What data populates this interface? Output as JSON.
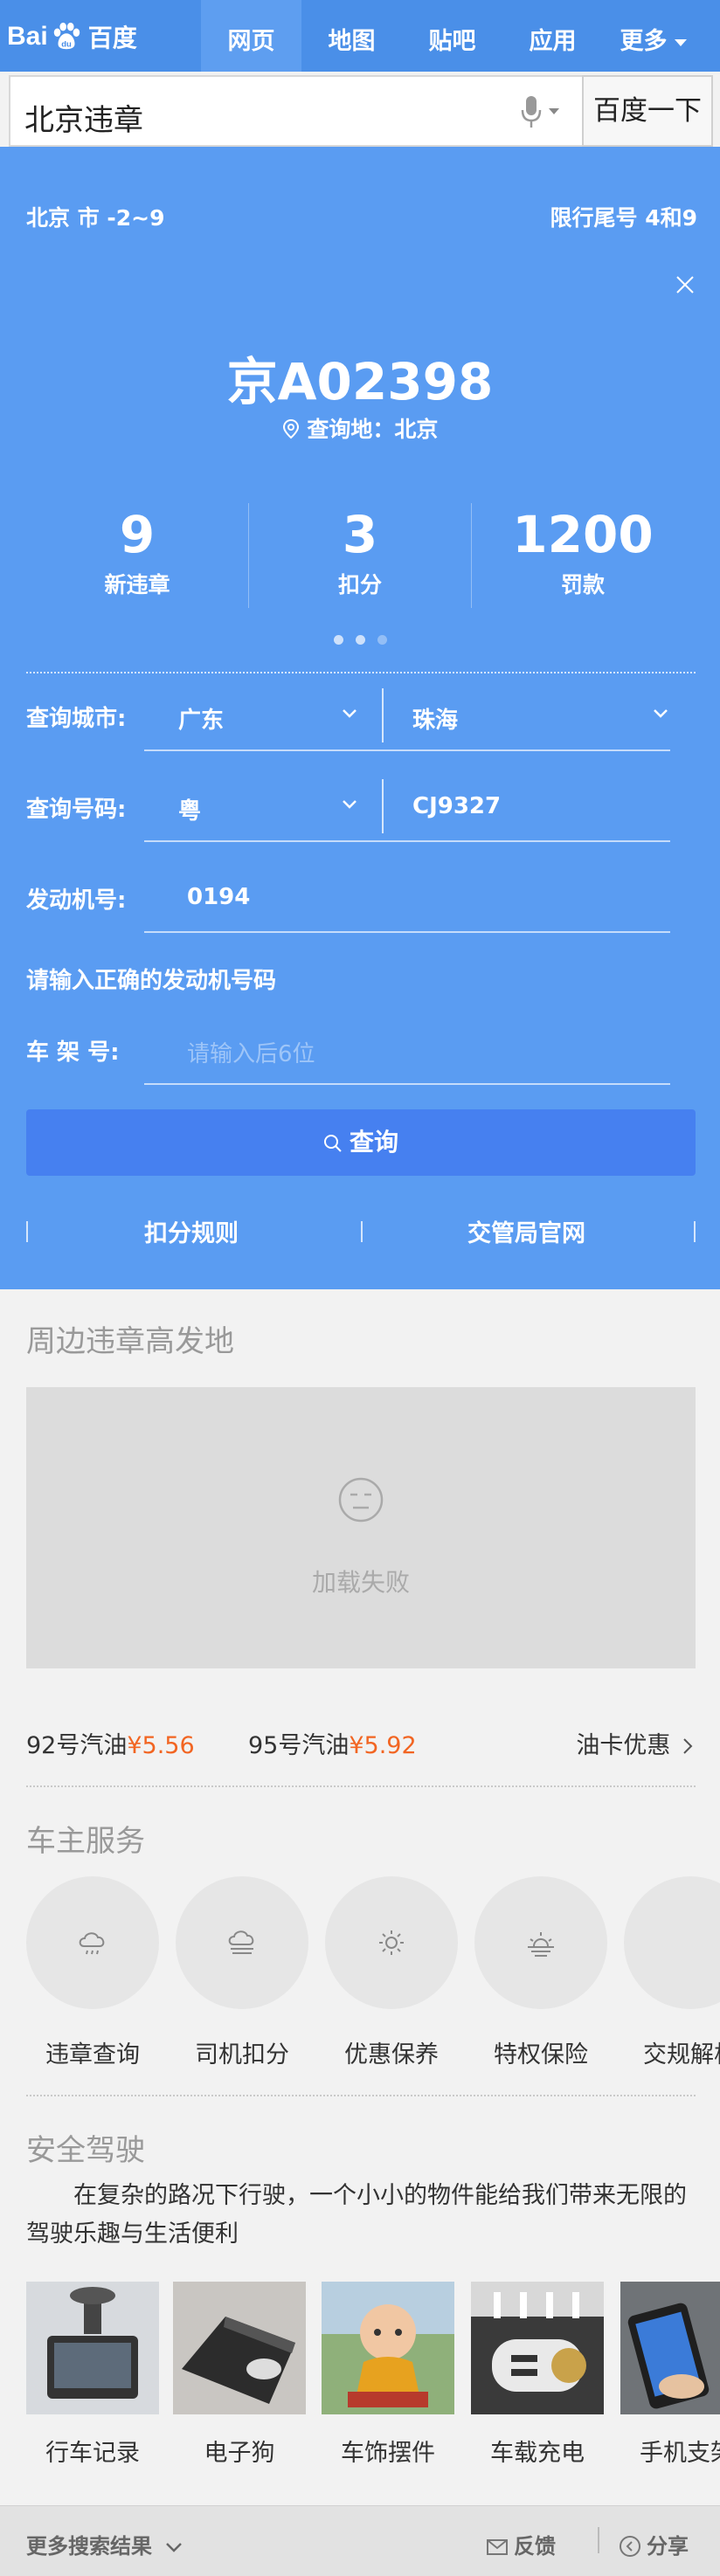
{
  "header": {
    "logo_text": "Bai",
    "logo_cn": "百度",
    "tabs": [
      {
        "label": "网页",
        "active": true
      },
      {
        "label": "地图",
        "active": false
      },
      {
        "label": "贴吧",
        "active": false
      },
      {
        "label": "应用",
        "active": false
      },
      {
        "label": "更多",
        "active": false,
        "dropdown": true
      }
    ],
    "search": {
      "value": "北京违章",
      "button": "百度一下"
    }
  },
  "card": {
    "weather": "北京 市 -2~9",
    "limit": "限行尾号 4和9",
    "plate": "京A02398",
    "location": "查询地：北京",
    "stats": [
      {
        "num": "9",
        "label": "新违章"
      },
      {
        "num": "3",
        "label": "扣分"
      },
      {
        "num": "1200",
        "label": "罚款"
      }
    ],
    "form": {
      "city_label": "查询城市:",
      "province": "广东",
      "city": "珠海",
      "plate_label": "查询号码:",
      "plate_prefix": "粤",
      "plate_no": "CJ9327",
      "engine_label": "发动机号:",
      "engine_no": "0194",
      "error": "请输入正确的发动机号码",
      "frame_label": "车 架 号:",
      "frame_placeholder": "请输入后6位"
    },
    "query_button": "查询",
    "links": [
      "扣分规则",
      "交管局官网"
    ]
  },
  "nearby": {
    "title": "周边违章高发地",
    "load_failed": "加载失败"
  },
  "oil": {
    "item1_label": "92号汽油",
    "item1_price": "¥5.56",
    "item2_label": "95号汽油",
    "item2_price": "¥5.92",
    "card_offer": "油卡优惠"
  },
  "services": {
    "title": "车主服务",
    "items": [
      {
        "label": "违章查询",
        "icon": "cloud-rain-icon"
      },
      {
        "label": "司机扣分",
        "icon": "cloud-fog-icon"
      },
      {
        "label": "优惠保养",
        "icon": "sun-icon"
      },
      {
        "label": "特权保险",
        "icon": "sunrise-icon"
      },
      {
        "label": "交规解析",
        "icon": "partial-icon"
      }
    ]
  },
  "safety": {
    "title": "安全驾驶",
    "paragraph": "在复杂的路况下行驶，一个小小的物件能给我们带来无限的驾驶乐趣与生活便利",
    "products": [
      "行车记录",
      "电子狗",
      "车饰摆件",
      "车载充电",
      "手机支架"
    ]
  },
  "footer": {
    "more": "更多搜索结果",
    "feedback": "反馈",
    "share": "分享"
  },
  "colors": {
    "brand_blue": "#4a8fe8",
    "panel_blue": "#5a9cf2",
    "price_orange": "#f26522"
  }
}
